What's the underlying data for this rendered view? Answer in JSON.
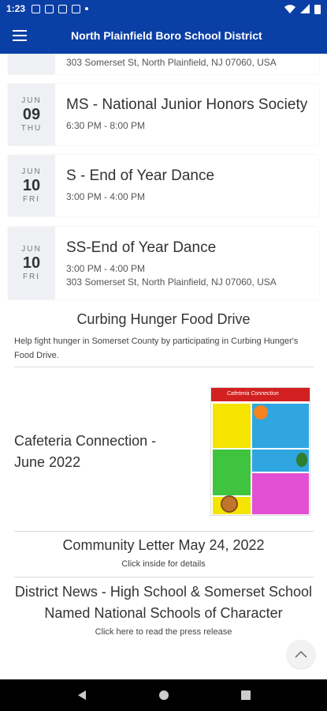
{
  "status": {
    "time": "1:23"
  },
  "appbar": {
    "title": "North Plainfield Boro School District"
  },
  "partial_event": {
    "location": "303 Somerset St, North Plainfield, NJ 07060, USA"
  },
  "events": [
    {
      "month": "JUN",
      "day": "09",
      "weekday": "THU",
      "title": "MS - National Junior Honors Society",
      "time": "6:30 PM - 8:00 PM",
      "location": ""
    },
    {
      "month": "JUN",
      "day": "10",
      "weekday": "FRI",
      "title": "S - End of Year Dance",
      "time": "3:00 PM - 4:00 PM",
      "location": ""
    },
    {
      "month": "JUN",
      "day": "10",
      "weekday": "FRI",
      "title": "SS-End of Year Dance",
      "time": "3:00 PM - 4:00 PM",
      "location": "303 Somerset St, North Plainfield, NJ 07060, USA"
    }
  ],
  "news": {
    "food_drive": {
      "title": "Curbing Hunger Food Drive",
      "body": "Help fight hunger in Somerset County by participating in Curbing Hunger's Food Drive."
    },
    "cafeteria": {
      "title": "Cafeteria Connection - June 2022",
      "image_title": "Cafeteria Connection"
    },
    "community": {
      "title": "Community Letter May 24, 2022",
      "sub": "Click inside for details"
    },
    "district": {
      "title": "District News - High School & Somerset School Named National Schools of Character",
      "sub": "Click here to read the press release"
    }
  },
  "colors": {
    "brand": "#0a3fa6"
  }
}
